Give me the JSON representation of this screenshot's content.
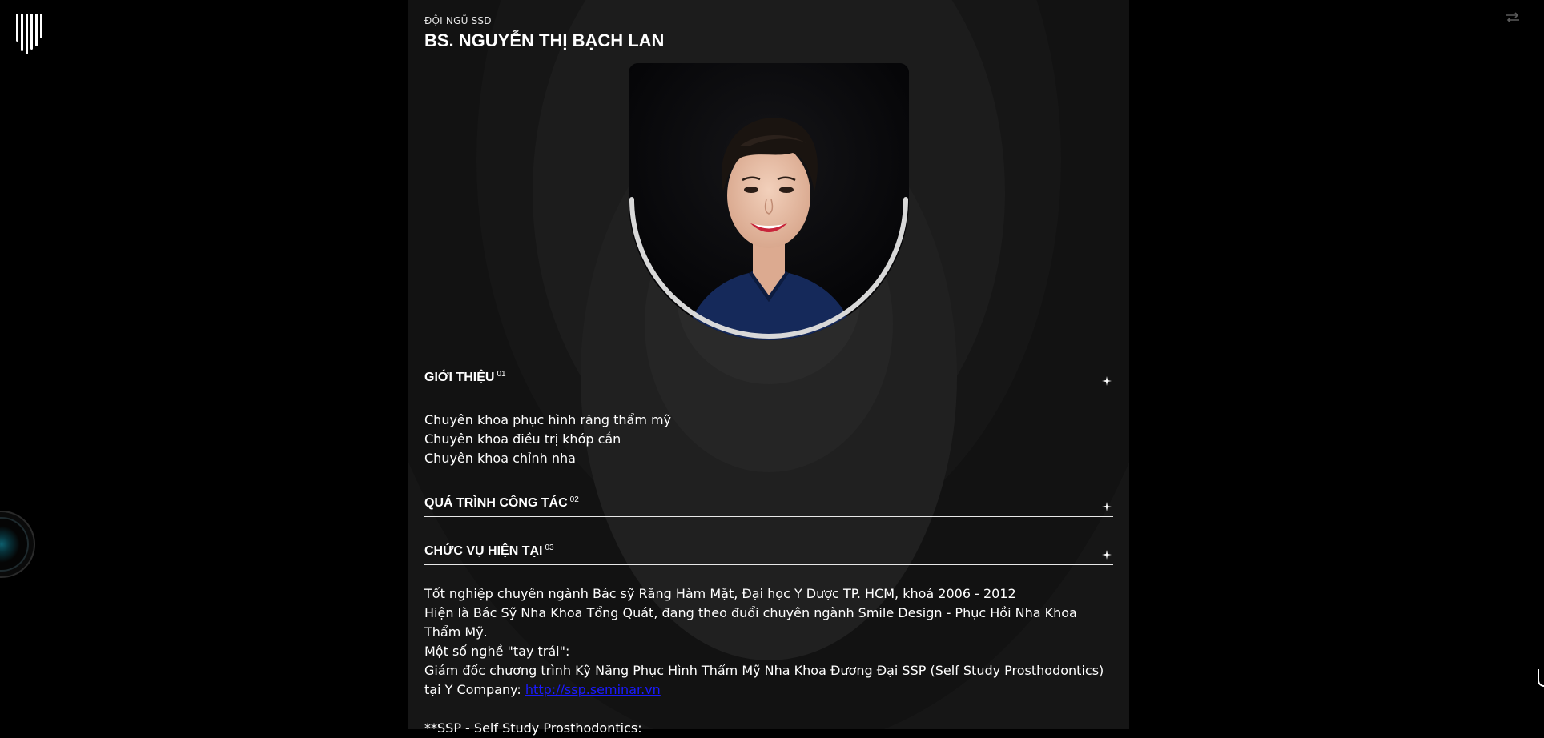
{
  "header": {
    "eyebrow": "ĐỘI NGŨ SSD",
    "title": "BS. NGUYỄN THỊ BẠCH LAN"
  },
  "icons": {
    "logo": "brand-logo-icon",
    "top_right": "swap-arrows-icon",
    "accordion_toggle": "plus-icon"
  },
  "sections": [
    {
      "title": "GIỚI THIỆU",
      "number": "01",
      "lines": [
        "Chuyên khoa phục hình răng thẩm mỹ",
        "Chuyên khoa điều trị khớp cắn",
        "Chuyên khoa chỉnh nha"
      ]
    },
    {
      "title": "QUÁ TRÌNH CÔNG TÁC",
      "number": "02"
    },
    {
      "title": "CHỨC VỤ HIỆN TẠI",
      "number": "03",
      "lines": [
        "Tốt nghiệp chuyên ngành Bác sỹ Răng Hàm Mặt, Đại học Y Dược TP. HCM, khoá 2006 - 2012",
        "Hiện là Bác Sỹ Nha Khoa Tổng Quát, đang theo đuổi chuyên ngành Smile Design - Phục Hồi Nha Khoa Thẩm Mỹ.",
        "Một số nghề \"tay trái\":",
        "Giám đốc chương trình Kỹ Năng Phục Hình Thẩm Mỹ Nha Khoa Đương Đại SSP (Self Study Prosthodontics) tại Y Company:"
      ],
      "link_text": "http://ssp.seminar.vn",
      "footnote": "**SSP - Self Study Prosthodontics:"
    }
  ],
  "colors": {
    "background": "#000000",
    "panel": "#161616",
    "text": "#ffffff",
    "link": "#1a1aff"
  }
}
